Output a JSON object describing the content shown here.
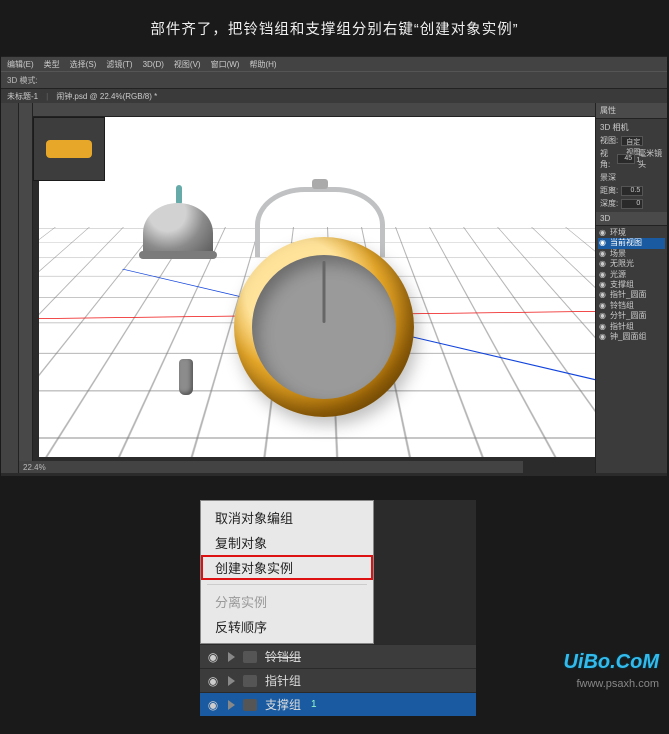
{
  "caption": "部件齐了，把铃铛组和支撑组分别右键“创建对象实例”",
  "menubar": [
    "编辑(E)",
    "类型",
    "选择(S)",
    "滤镜(T)",
    "3D(D)",
    "视图(V)",
    "窗口(W)",
    "帮助(H)"
  ],
  "options": {
    "label": "3D 模式:"
  },
  "doc_tabs": [
    "未标题-1",
    "闹钟.psd @ 22.4%(RGB/8) *"
  ],
  "thumb": {
    "name": "swatch-thumb"
  },
  "panels": {
    "props_title": "属性",
    "camera": "3D 相机",
    "view_label": "视图:",
    "view_value": "自定视图 1",
    "fov_label": "视角:",
    "fov_value": "45",
    "mm": "毫米镜头",
    "dof_label": "景深",
    "dist_label": "距离:",
    "dist_value": "0.5",
    "depth_label": "深度:",
    "depth_value": "0"
  },
  "tree": {
    "title": "3D",
    "items": [
      {
        "t": "环境"
      },
      {
        "t": "当前视图",
        "sel": true
      },
      {
        "t": "场景"
      },
      {
        "t": "无限光"
      },
      {
        "t": "光源"
      },
      {
        "t": "支撑组"
      },
      {
        "t": "指针_圆面"
      },
      {
        "t": "铃铛组"
      },
      {
        "t": "分针_圆面"
      },
      {
        "t": "指针组"
      },
      {
        "t": "钟_圆面组"
      }
    ]
  },
  "footer": "22.4%",
  "context_menu": [
    {
      "t": "取消对象编组",
      "d": false
    },
    {
      "t": "复制对象",
      "d": false
    },
    {
      "t": "创建对象实例",
      "d": false,
      "hl": true
    },
    {
      "sep": true
    },
    {
      "t": "分离实例",
      "d": true
    },
    {
      "t": "反转顺序",
      "d": false
    }
  ],
  "layer_rows": [
    {
      "t": "铃铛组",
      "sel": false,
      "strike": true
    },
    {
      "t": "指针组",
      "sel": false
    },
    {
      "t": "支撑组",
      "sel": true,
      "count": "1"
    }
  ],
  "watermark": {
    "a": "UiBo.CoM",
    "b": "fwww.psaxh.com"
  }
}
